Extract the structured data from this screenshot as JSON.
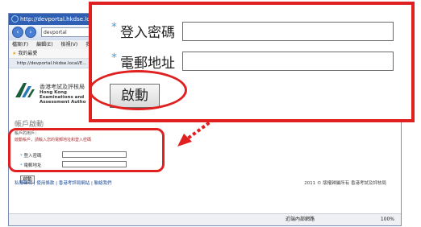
{
  "browser": {
    "title": "http://devportal.hkdse.local/E...",
    "address": "devportal",
    "menu": [
      "檔案(F)",
      "編輯(E)",
      "檢視(V)",
      "我"
    ],
    "favorites_label": "我的最愛",
    "tab_url": "http://devportal.hkdse.local/E..."
  },
  "site": {
    "org_name_zh": "香港考試及評核局",
    "org_name_en_1": "Hong Kong",
    "org_name_en_2": "Examinations and",
    "org_name_en_3": "Assessment Autho"
  },
  "page": {
    "heading": "帳戶啟動",
    "user_label": "帳戶的用戶：",
    "instruction": "啟動帳戶，請輸入您的電郵地址和登入密碼",
    "password_label": "登入密碼",
    "email_label": "電郵地址",
    "activate_label": "啟動",
    "footer_links": "私隱聲明 | 使用條款 | 香港考評局網站 | 聯絡我們",
    "copyright": "2011 © 版權歸屬所有 香港考試及評核局"
  },
  "status": {
    "zone": "近端內部網路",
    "zoom": "100%"
  },
  "callout": {
    "asterisk": "*",
    "password_label": "登入密碼",
    "email_label": "電郵地址",
    "activate_label": "啟動"
  },
  "colors": {
    "highlight": "#e02020",
    "asterisk": "#4aa0d8"
  }
}
